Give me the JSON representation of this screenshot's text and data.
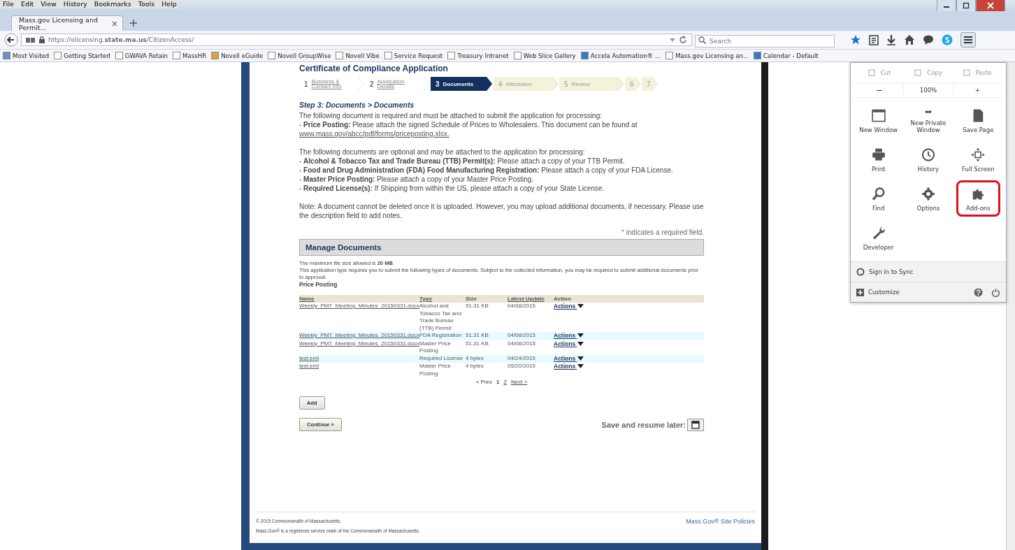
{
  "menu_bar": [
    "File",
    "Edit",
    "View",
    "History",
    "Bookmarks",
    "Tools",
    "Help"
  ],
  "tabs": [
    {
      "label": "Mass.gov Licensing and Permit...",
      "selected": true
    }
  ],
  "address_bar": {
    "url": "https://elicensing.**state.ma.us**/CitizenAccess/"
  },
  "search": {
    "placeholder": "Search"
  },
  "bookmarks": [
    "Most Visited",
    "Getting Started",
    "GWAVA Retain",
    "MassHR",
    "Novell eGuide",
    "Novell GroupWise",
    "Novell Vibe",
    "Service Request",
    "Treasury Intranet",
    "Web Slice Gallery",
    "Accela Automation® ...",
    "Mass.gov Licensing an...",
    "Calendar - Default"
  ],
  "page": {
    "title": "Certificate of Compliance Application",
    "steps": [
      {
        "number": "1",
        "label": "Business & Contact Info",
        "completed": true,
        "current": false
      },
      {
        "number": "2",
        "label": "Application Details",
        "completed": true,
        "current": false
      },
      {
        "number": "3",
        "label": "Documents",
        "completed": false,
        "current": true
      },
      {
        "number": "4",
        "label": "Attestation",
        "completed": false,
        "current": false
      },
      {
        "number": "5",
        "label": "Review",
        "completed": false,
        "current": false
      },
      {
        "number": "6",
        "completed": false,
        "current": false
      },
      {
        "number": "7",
        "completed": false,
        "current": false
      }
    ],
    "section_heading": "Step 3: Documents > Documents",
    "required_intro": "The following document is required and must be attached to submit the application for processing:",
    "required_item": "- **Price Posting:** Please attach the signed Schedule of Prices to Wholesalers. This document can be found at",
    "required_link": "www.mass.gov/abcc/pdf/forms/priceposting.xlsx.",
    "optional_intro": "The following documents are optional and may be attached to the application for processing:",
    "optional_items": [
      "- **Alcohol & Tobacco Tax and Trade Bureau (TTB) Permit(s):** Please attach a copy of your TTB Permit.",
      "- **Food and Drug Administration (FDA) Food Manufacturing Registration:** Please attach a copy of your FDA License.",
      "- **Master Price Posting:** Please attach a copy of your Master Price Posting.",
      "- **Required License(s):** If Shipping from within the US, please attach a copy of your State License."
    ],
    "note": "Note: A document cannot be deleted once it is uploaded. However, you may upload additional documents, if necessary. Please use the description field to add notes.",
    "required_mark": "*",
    "required_legend": "indicates a required field.",
    "manage": {
      "title": "Manage Documents",
      "max_size": "The maximum file size allowed is **20 MB**.",
      "info": "This application type requires you to submit the following types of documents. Subject to the collected information, you may be required to submit additional documents prior to approval.",
      "subheading": "Price Posting",
      "columns": [
        {
          "label": "Name",
          "sortable": true
        },
        {
          "label": "Type",
          "sortable": true
        },
        {
          "label": "Size",
          "sortable": false
        },
        {
          "label": "Latest Update",
          "sortable": true
        },
        {
          "label": "Action",
          "sortable": false
        }
      ],
      "rows": [
        {
          "name": "Weekly_PMT_Meeting_Minutes_20150331.docx",
          "type": "Alcohol and Tobacco Tax and Trade Bureau (TTB) Permit",
          "size": "51.31 KB",
          "date": "04/08/2015",
          "action": "Actions",
          "highlighted": false
        },
        {
          "name": "Weekly_PMT_Meeting_Minutes_20150331.docx",
          "type": "FDA Registration",
          "size": "51.31 KB",
          "date": "04/08/2015",
          "action": "Actions",
          "highlighted": true
        },
        {
          "name": "Weekly_PMT_Meeting_Minutes_20150331.docx",
          "type": "Master Price Posting",
          "size": "51.31 KB",
          "date": "04/08/2015",
          "action": "Actions",
          "highlighted": false
        },
        {
          "name": "test.eml",
          "type": "Required License",
          "size": "4 bytes",
          "date": "04/24/2015",
          "action": "Actions",
          "highlighted": true
        },
        {
          "name": "test.eml",
          "type": "Master Price Posting",
          "size": "4 bytes",
          "date": "05/20/2015",
          "action": "Actions",
          "highlighted": false
        }
      ],
      "pagination": {
        "prev": "< Prev",
        "pages": [
          {
            "label": "1",
            "selected": true
          },
          {
            "label": "2",
            "selected": false
          }
        ],
        "next": "Next >"
      },
      "add_button": "Add"
    },
    "continue_button": "Continue »",
    "save_label": "Save and resume later:",
    "footer": {
      "copyright": "© 2015 Commonwealth of Massachusetts.",
      "trademark": "Mass.Gov® is a registered service mark of the Commonwealth of Massachusetts.",
      "policies_link": "Mass.Gov® Site Policies"
    }
  },
  "app_menu": {
    "edit_row": [
      {
        "label": "Cut",
        "disabled": true
      },
      {
        "label": "Copy",
        "disabled": true
      },
      {
        "label": "Paste",
        "disabled": true
      }
    ],
    "zoom_row": [
      "−",
      "100%",
      "+"
    ],
    "items": [
      {
        "label": "New Window",
        "highlighted": false
      },
      {
        "label": "New Private Window",
        "highlighted": false
      },
      {
        "label": "Save Page",
        "highlighted": false
      },
      {
        "label": "Print",
        "highlighted": false
      },
      {
        "label": "History",
        "highlighted": false
      },
      {
        "label": "Full Screen",
        "highlighted": false
      },
      {
        "label": "Find",
        "highlighted": false
      },
      {
        "label": "Options",
        "highlighted": false
      },
      {
        "label": "Add-ons",
        "highlighted": true
      },
      {
        "label": "Developer",
        "highlighted": false
      }
    ],
    "sync": "Sign in to Sync",
    "customize": "Customize"
  }
}
